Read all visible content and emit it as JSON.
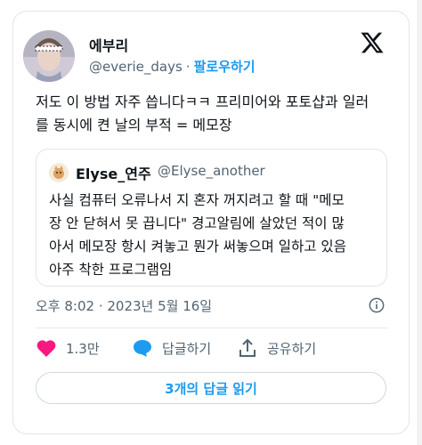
{
  "author": {
    "display_name": "에부리",
    "handle": "@everie_days",
    "separator": "·",
    "follow_label": "팔로우하기"
  },
  "tweet": {
    "text": "저도 이 방법 자주 씁니다ㅋㅋ 프리미어와 포토샵과 일러\n를 동시에 켠 날의 부적 = 메모장",
    "timestamp": "오후 8:02 · 2023년 5월 16일"
  },
  "quote": {
    "display_name": "Elyse_연주",
    "handle": "@Elyse_another",
    "text": "사실 컴퓨터 오류나서 지 혼자 꺼지려고 할 때 \"메모\n장 안 닫혀서 못 끕니다\" 경고알림에 살았던 적이 많\n아서 메모장 항시 켜놓고 뭔가 써놓으며 일하고 있음\n아주 착한 프로그램임"
  },
  "actions": {
    "like_count": "1.3만",
    "reply_label": "답글하기",
    "share_label": "공유하기"
  },
  "replies_button": "3개의 답글 읽기",
  "icons": [
    "x-logo-icon",
    "info-icon",
    "heart-icon",
    "reply-bubble-icon",
    "share-icon"
  ],
  "colors": {
    "accent": "#1d9bf0",
    "like": "#f91880",
    "text": "#0f1419",
    "muted": "#536471"
  }
}
